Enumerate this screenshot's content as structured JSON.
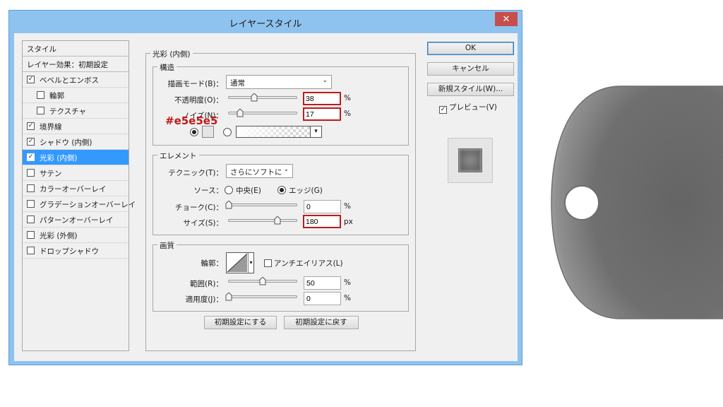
{
  "window": {
    "title": "レイヤースタイル",
    "close_glyph": "✕"
  },
  "styles": {
    "header": "スタイル",
    "default_label": "レイヤー効果：初期設定",
    "items": [
      {
        "label": "ベベルとエンボス",
        "checked": true
      },
      {
        "label": "輪郭",
        "checked": false,
        "sub": true
      },
      {
        "label": "テクスチャ",
        "checked": false,
        "sub": true
      },
      {
        "label": "境界線",
        "checked": true
      },
      {
        "label": "シャドウ (内側)",
        "checked": true
      },
      {
        "label": "光彩 (内側)",
        "checked": true,
        "selected": true
      },
      {
        "label": "サテン",
        "checked": false
      },
      {
        "label": "カラーオーバーレイ",
        "checked": false
      },
      {
        "label": "グラデーションオーバーレイ",
        "checked": false
      },
      {
        "label": "パターンオーバーレイ",
        "checked": false
      },
      {
        "label": "光彩 (外側)",
        "checked": false
      },
      {
        "label": "ドロップシャドウ",
        "checked": false
      }
    ]
  },
  "panel": {
    "title": "光彩 (内側)",
    "structure": {
      "title": "構造",
      "blend_mode_label": "描画モード(B)：",
      "blend_mode_value": "通常",
      "opacity_label": "不透明度(O)：",
      "opacity_value": "38",
      "opacity_level": 38,
      "noise_label": "ノイズ(N)：",
      "noise_value": "17",
      "noise_level": 17,
      "percent": "%",
      "color_annotation": "#e5e5e5",
      "color": "#e5e5e5"
    },
    "elements": {
      "title": "エレメント",
      "technique_label": "テクニック(T)：",
      "technique_value": "さらにソフトに",
      "source_label": "ソース：",
      "source_center": "中央(E)",
      "source_edge": "エッジ(G)",
      "choke_label": "チョーク(C)：",
      "choke_value": "0",
      "choke_level": 0,
      "size_label": "サイズ(S)：",
      "size_value": "180",
      "size_level": 72,
      "percent": "%",
      "px": "px"
    },
    "quality": {
      "title": "画質",
      "contour_label": "輪郭：",
      "antialias_label": "アンチエイリアス(L)",
      "range_label": "範囲(R)：",
      "range_value": "50",
      "range_level": 50,
      "jitter_label": "適用度(J)：",
      "jitter_value": "0",
      "jitter_level": 0,
      "percent": "%"
    },
    "make_default": "初期設定にする",
    "reset_default": "初期設定に戻す"
  },
  "buttons": {
    "ok": "OK",
    "cancel": "キャンセル",
    "new_style": "新規スタイル(W)...",
    "preview": "プレビュー(V)"
  },
  "icons": {
    "checkmark": "✓",
    "dropdown": "⌄",
    "triangle_down": "▾"
  }
}
